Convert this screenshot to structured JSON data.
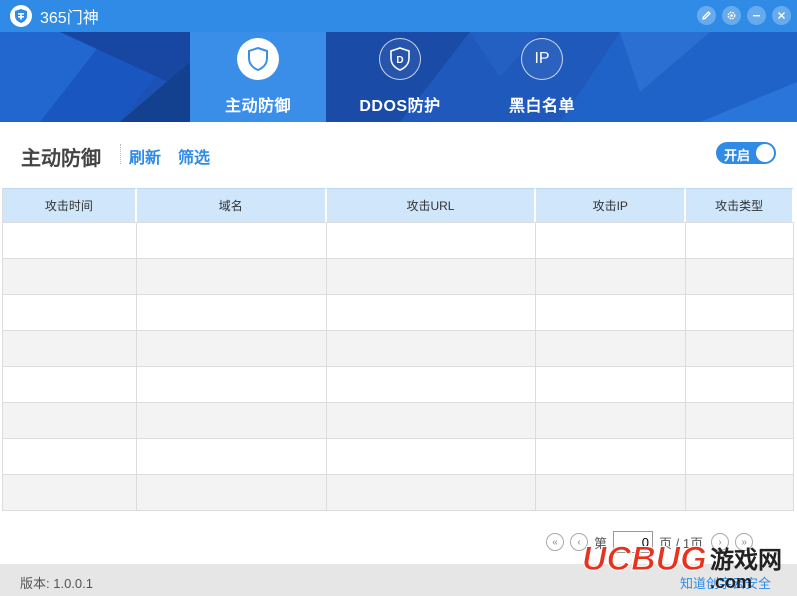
{
  "app": {
    "title": "365门神"
  },
  "window_buttons": [
    {
      "name": "edit",
      "icon": "pencil-icon"
    },
    {
      "name": "settings",
      "icon": "gear-icon"
    },
    {
      "name": "minimize",
      "icon": "minus-icon"
    },
    {
      "name": "close",
      "icon": "close-icon"
    }
  ],
  "nav": {
    "tabs": [
      {
        "label": "主动防御",
        "icon": "shield-icon",
        "active": true
      },
      {
        "label": "DDOS防护",
        "icon": "ddos-shield-icon",
        "icon_text": "D",
        "active": false
      },
      {
        "label": "黑白名单",
        "icon": "ip-icon",
        "icon_text": "IP",
        "active": false
      }
    ]
  },
  "toolbar": {
    "title": "主动防御",
    "refresh_label": "刷新",
    "filter_label": "筛选",
    "toggle_label": "开启",
    "toggle_on": true
  },
  "table": {
    "columns": [
      "攻击时间",
      "域名",
      "攻击URL",
      "攻击IP",
      "攻击类型"
    ],
    "rows": [
      [
        "",
        "",
        "",
        "",
        ""
      ],
      [
        "",
        "",
        "",
        "",
        ""
      ],
      [
        "",
        "",
        "",
        "",
        ""
      ],
      [
        "",
        "",
        "",
        "",
        ""
      ],
      [
        "",
        "",
        "",
        "",
        ""
      ],
      [
        "",
        "",
        "",
        "",
        ""
      ],
      [
        "",
        "",
        "",
        "",
        ""
      ],
      [
        "",
        "",
        "",
        "",
        ""
      ]
    ]
  },
  "pagination": {
    "prefix": "第",
    "current": "0",
    "suffix": "页 / 1页"
  },
  "status": {
    "version": "版本: 1.0.0.1",
    "about_link": "知道创宇云安全"
  },
  "watermark": {
    "brand": "UCBUG",
    "text": "游戏网",
    "domain": ".com"
  },
  "colors": {
    "primary": "#2f8be6",
    "banner": "#1b4fae",
    "header_row": "#cfe6fb"
  }
}
